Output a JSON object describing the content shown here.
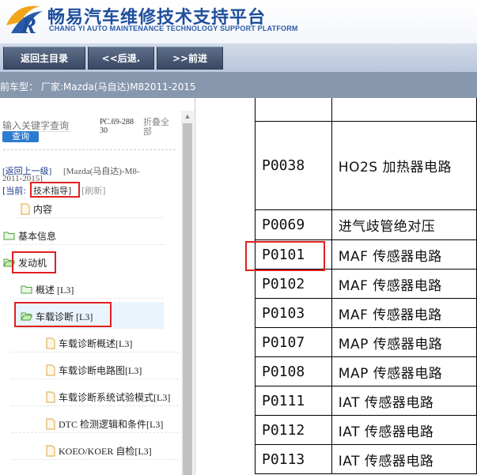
{
  "header": {
    "title_cn": "畅易汽车维修技术支持平台",
    "title_en": "CHANG YI AUTO MAINTENANCE TECHNOLOGY SUPPORT PLATFORM",
    "brand_color": "#1f4e9c"
  },
  "nav": {
    "main_menu": "返回主目录",
    "back": "<<后退.",
    "forward": ">>前进"
  },
  "car_bar": {
    "text": "前车型： 厂家:Mazda(马自达)M82011-2015"
  },
  "left_panel": {
    "search_placeholder": "输入关键字查询",
    "query_button": "查询",
    "pc_code": "PC.69-28830",
    "collapse_all": "折叠全部",
    "back_link": "[返回上一级]",
    "back_model": "[Mazda(马自达)-M8-",
    "back_year": "2011-2015]",
    "current_label": "[当前:",
    "current_value": "技术指导]",
    "refresh": "[刷新]",
    "tree": [
      {
        "label": "内容",
        "icon": "file-icon"
      },
      {
        "label": "基本信息",
        "icon": "folder-icon"
      },
      {
        "label": "发动机",
        "icon": "folder-open-icon"
      },
      {
        "label": "概述 [L3]",
        "icon": "folder-icon"
      },
      {
        "label": "车载诊断 [L3]",
        "icon": "folder-open-icon"
      },
      {
        "label": "车载诊断概述[L3]",
        "icon": "file-icon"
      },
      {
        "label": "车载诊断电路图[L3]",
        "icon": "file-icon"
      },
      {
        "label": "车载诊断系统试验模式[L3]",
        "icon": "file-icon"
      },
      {
        "label": "DTC 检测逻辑和条件[L3]",
        "icon": "file-icon"
      },
      {
        "label": "KOEO/KOER 自检[L3]",
        "icon": "file-icon"
      }
    ]
  },
  "dtc_table": {
    "rows": [
      {
        "code": "",
        "desc": ""
      },
      {
        "code": "P0038",
        "desc": "HO2S 加热器电路"
      },
      {
        "code": "P0069",
        "desc": "进气歧管绝对压"
      },
      {
        "code": "P0101",
        "desc": "MAF 传感器电路"
      },
      {
        "code": "P0102",
        "desc": "MAF 传感器电路"
      },
      {
        "code": "P0103",
        "desc": "MAF 传感器电路"
      },
      {
        "code": "P0107",
        "desc": "MAP 传感器电路"
      },
      {
        "code": "P0108",
        "desc": "MAP 传感器电路"
      },
      {
        "code": "P0111",
        "desc": "IAT 传感器电路"
      },
      {
        "code": "P0112",
        "desc": "IAT 传感器电路"
      },
      {
        "code": "P0113",
        "desc": "IAT 传感器电路"
      }
    ]
  },
  "colors": {
    "nav_button": "#394862",
    "car_bar": "#8797ad",
    "highlight": "#e02020",
    "query_button": "#2b7bd1"
  }
}
